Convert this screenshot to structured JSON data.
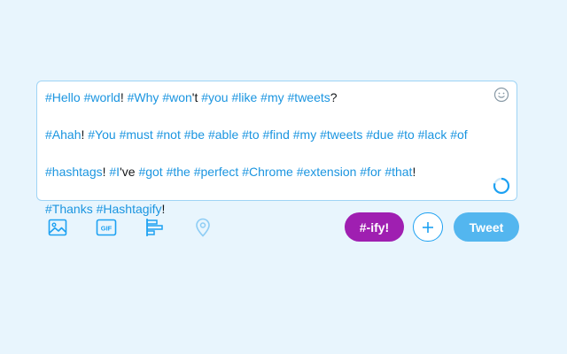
{
  "composer": {
    "lines": [
      [
        {
          "t": "#Hello",
          "hash": true
        },
        {
          "t": " "
        },
        {
          "t": "#world",
          "hash": true
        },
        {
          "t": "! "
        },
        {
          "t": "#Why",
          "hash": true
        },
        {
          "t": " "
        },
        {
          "t": "#won",
          "hash": true
        },
        {
          "t": "'t "
        },
        {
          "t": "#you",
          "hash": true
        },
        {
          "t": " "
        },
        {
          "t": "#like",
          "hash": true
        },
        {
          "t": " "
        },
        {
          "t": "#my",
          "hash": true
        },
        {
          "t": " "
        },
        {
          "t": "#tweets",
          "hash": true
        },
        {
          "t": "?"
        }
      ],
      [
        {
          "t": "#Ahah",
          "hash": true
        },
        {
          "t": "! "
        },
        {
          "t": "#You",
          "hash": true
        },
        {
          "t": " "
        },
        {
          "t": "#must",
          "hash": true
        },
        {
          "t": " "
        },
        {
          "t": "#not",
          "hash": true
        },
        {
          "t": " "
        },
        {
          "t": "#be",
          "hash": true
        },
        {
          "t": " "
        },
        {
          "t": "#able",
          "hash": true
        },
        {
          "t": " "
        },
        {
          "t": "#to",
          "hash": true
        },
        {
          "t": " "
        },
        {
          "t": "#find",
          "hash": true
        },
        {
          "t": " "
        },
        {
          "t": "#my",
          "hash": true
        },
        {
          "t": " "
        },
        {
          "t": "#tweets",
          "hash": true
        },
        {
          "t": " "
        },
        {
          "t": "#due",
          "hash": true
        },
        {
          "t": " "
        },
        {
          "t": "#to",
          "hash": true
        },
        {
          "t": " "
        },
        {
          "t": "#lack",
          "hash": true
        },
        {
          "t": " "
        },
        {
          "t": "#of",
          "hash": true
        }
      ],
      [
        {
          "t": "#hashtags",
          "hash": true
        },
        {
          "t": "! "
        },
        {
          "t": "#I",
          "hash": true
        },
        {
          "t": "'ve "
        },
        {
          "t": "#got",
          "hash": true
        },
        {
          "t": " "
        },
        {
          "t": "#the",
          "hash": true
        },
        {
          "t": " "
        },
        {
          "t": "#perfect",
          "hash": true
        },
        {
          "t": " "
        },
        {
          "t": "#Chrome",
          "hash": true
        },
        {
          "t": " "
        },
        {
          "t": "#extension",
          "hash": true
        },
        {
          "t": " "
        },
        {
          "t": "#for",
          "hash": true
        },
        {
          "t": " "
        },
        {
          "t": "#that",
          "hash": true
        },
        {
          "t": "!"
        }
      ],
      [
        {
          "t": "#Thanks",
          "hash": true
        },
        {
          "t": " "
        },
        {
          "t": "#Hashtagify",
          "hash": true
        },
        {
          "t": "!"
        }
      ]
    ],
    "char_count_progress": 0.8,
    "emoji_icon": "smiley-icon"
  },
  "toolbar": {
    "media_icon": "image-icon",
    "gif_label": "GIF",
    "poll_icon": "poll-icon",
    "location_icon": "location-pin-icon",
    "ify_label": "#-ify!",
    "add_label": "+",
    "tweet_label": "Tweet"
  },
  "colors": {
    "background": "#e8f5fd",
    "accent": "#1da1f2",
    "ify_purple": "#9f1fb1",
    "tweet_button": "#53b6ef",
    "icon_muted": "#8ecdf5"
  }
}
